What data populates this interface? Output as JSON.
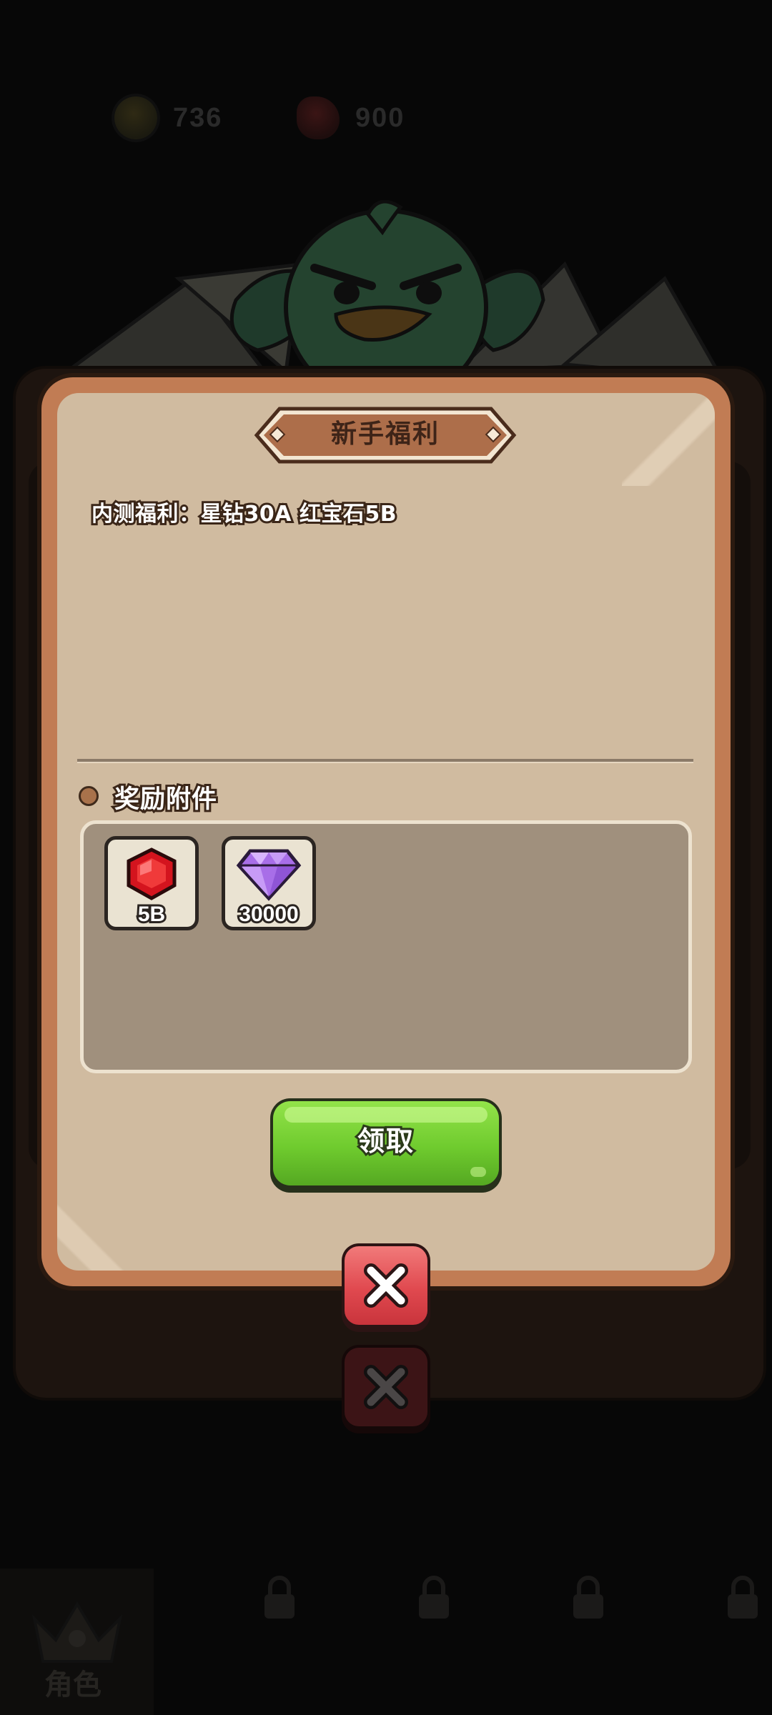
{
  "currency": {
    "coins": "736",
    "gems": "900"
  },
  "dialog": {
    "title": "新手福利",
    "message": "内测福利：星钻30A  红宝石5B",
    "attachments_title": "奖励附件",
    "items": [
      {
        "icon": "ruby-icon",
        "quantity": "5B"
      },
      {
        "icon": "diamond-icon",
        "quantity": "30000"
      }
    ],
    "claim_label": "领取"
  },
  "bottom_nav": {
    "role_label": "角色"
  },
  "colors": {
    "dialog_border": "#c17c54",
    "dialog_body": "#d0bba0",
    "attach_box": "#a0907d",
    "claim_green": "#6fcb2e",
    "close_red": "#e0494f"
  }
}
